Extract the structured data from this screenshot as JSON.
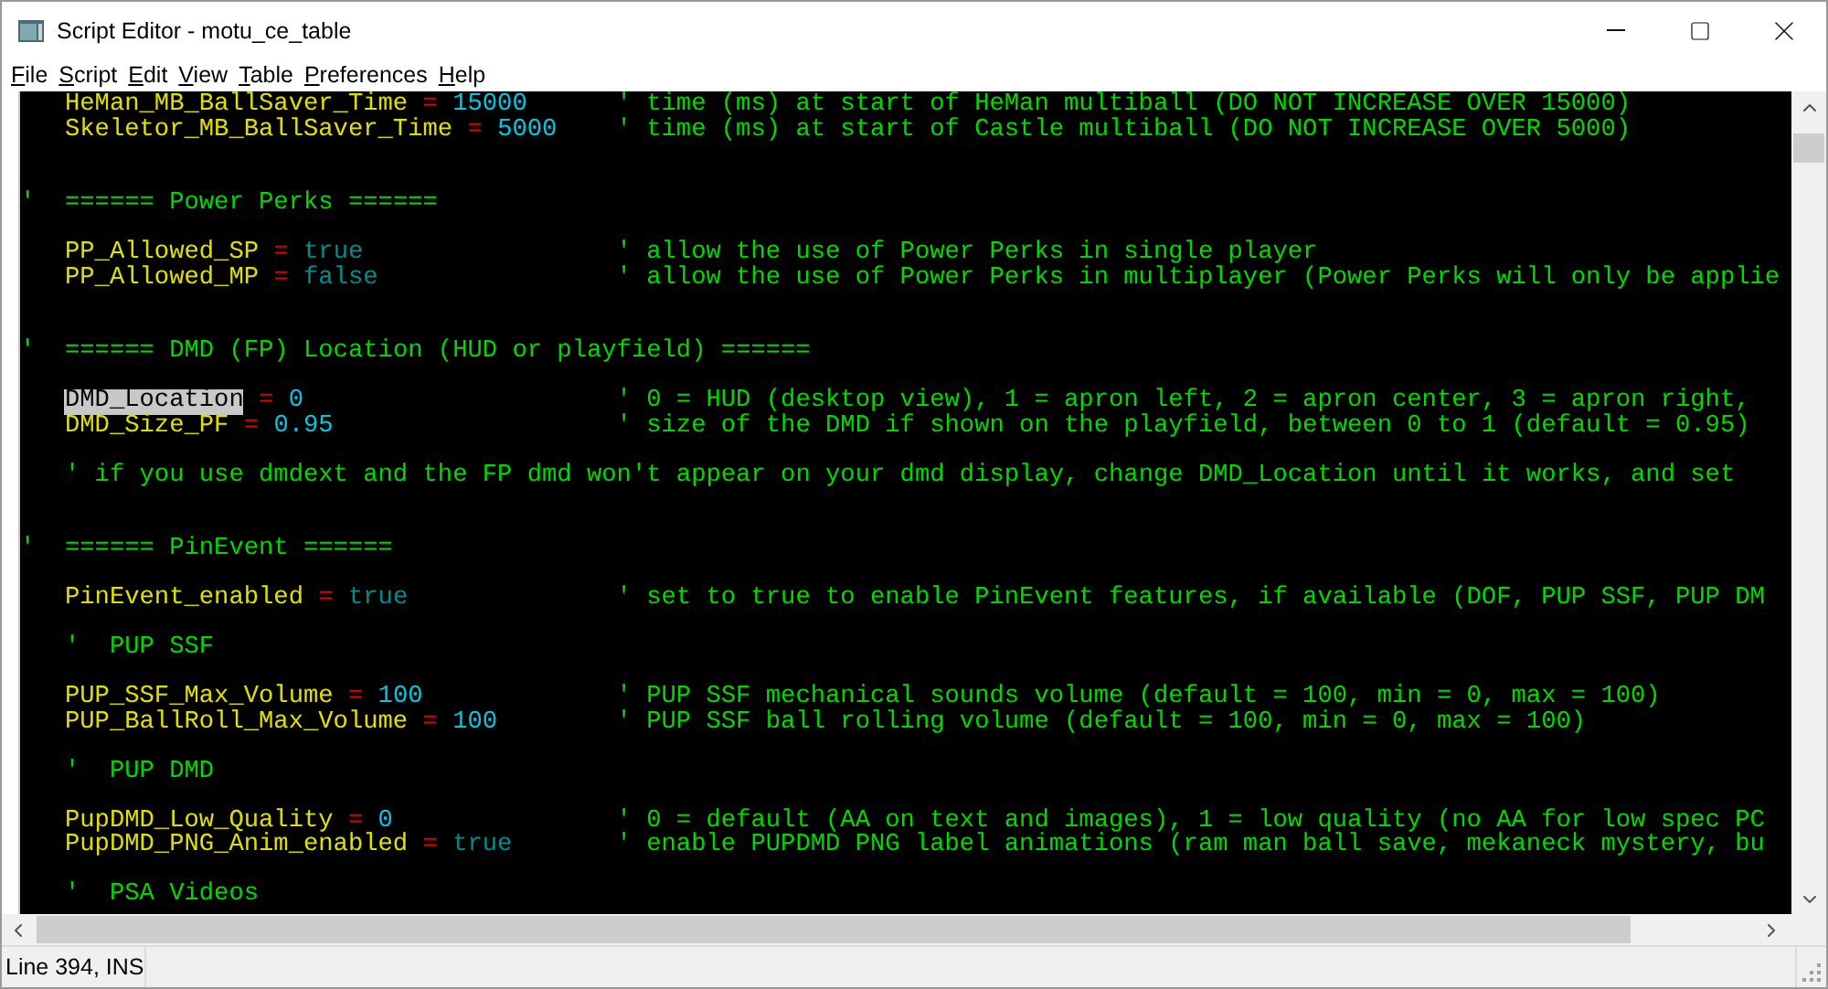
{
  "window": {
    "title": "Script Editor - motu_ce_table"
  },
  "menu": [
    "File",
    "Script",
    "Edit",
    "View",
    "Table",
    "Preferences",
    "Help"
  ],
  "editor": {
    "lines": [
      {
        "kind": "setting",
        "name": "HeMan_MB_BallSaver_Time",
        "operator": "=",
        "value": {
          "kind": "number",
          "text": "15000"
        },
        "comment": "' time (ms) at start of HeMan multiball (DO NOT INCREASE OVER 15000)",
        "selected": false
      },
      {
        "kind": "setting",
        "name": "Skeletor_MB_BallSaver_Time",
        "operator": "=",
        "value": {
          "kind": "number",
          "text": "5000"
        },
        "comment": "' time (ms) at start of Castle multiball (DO NOT INCREASE OVER 5000)",
        "selected": false
      },
      {
        "kind": "blank"
      },
      {
        "kind": "blank"
      },
      {
        "kind": "section",
        "text": "'  ====== Power Perks ======"
      },
      {
        "kind": "blank"
      },
      {
        "kind": "setting",
        "name": "PP_Allowed_SP",
        "operator": "=",
        "value": {
          "kind": "boolean",
          "text": "true"
        },
        "comment": "' allow the use of Power Perks in single player",
        "selected": false
      },
      {
        "kind": "setting",
        "name": "PP_Allowed_MP",
        "operator": "=",
        "value": {
          "kind": "boolean",
          "text": "false"
        },
        "comment": "' allow the use of Power Perks in multiplayer (Power Perks will only be applie",
        "selected": false
      },
      {
        "kind": "blank"
      },
      {
        "kind": "blank"
      },
      {
        "kind": "section",
        "text": "'  ====== DMD (FP) Location (HUD or playfield) ======"
      },
      {
        "kind": "blank"
      },
      {
        "kind": "setting",
        "name": "DMD_Location",
        "operator": "=",
        "value": {
          "kind": "number",
          "text": "0"
        },
        "comment": "' 0 = HUD (desktop view), 1 = apron left, 2 = apron center, 3 = apron right,",
        "selected": true
      },
      {
        "kind": "setting",
        "name": "DMD_Size_PF",
        "operator": "=",
        "value": {
          "kind": "number",
          "text": "0.95"
        },
        "comment": "' size of the DMD if shown on the playfield, between 0 to 1 (default = 0.95)",
        "selected": false
      },
      {
        "kind": "blank"
      },
      {
        "kind": "note",
        "text": "' if you use dmdext and the FP dmd won't appear on your dmd display, change DMD_Location until it works, and set"
      },
      {
        "kind": "blank"
      },
      {
        "kind": "blank"
      },
      {
        "kind": "section",
        "text": "'  ====== PinEvent ======"
      },
      {
        "kind": "blank"
      },
      {
        "kind": "setting",
        "name": "PinEvent_enabled",
        "operator": "=",
        "value": {
          "kind": "boolean",
          "text": "true"
        },
        "comment": "' set to true to enable PinEvent features, if available (DOF, PUP SSF, PUP DM",
        "selected": false
      },
      {
        "kind": "blank"
      },
      {
        "kind": "note",
        "text": "'  PUP SSF"
      },
      {
        "kind": "blank"
      },
      {
        "kind": "setting",
        "name": "PUP_SSF_Max_Volume",
        "operator": "=",
        "value": {
          "kind": "number",
          "text": "100"
        },
        "comment": "' PUP SSF mechanical sounds volume (default = 100, min = 0, max = 100)",
        "selected": false
      },
      {
        "kind": "setting",
        "name": "PUP_BallRoll_Max_Volume",
        "operator": "=",
        "value": {
          "kind": "number",
          "text": "100"
        },
        "comment": "' PUP SSF ball rolling volume (default = 100, min = 0, max = 100)",
        "selected": false
      },
      {
        "kind": "blank"
      },
      {
        "kind": "note",
        "text": "'  PUP DMD"
      },
      {
        "kind": "blank"
      },
      {
        "kind": "setting",
        "name": "PupDMD_Low_Quality",
        "operator": "=",
        "value": {
          "kind": "number",
          "text": "0"
        },
        "comment": "' 0 = default (AA on text and images), 1 = low quality (no AA for low spec PC",
        "selected": false
      },
      {
        "kind": "setting",
        "name": "PupDMD_PNG_Anim_enabled",
        "operator": "=",
        "value": {
          "kind": "boolean",
          "text": "true"
        },
        "comment": "' enable PUPDMD PNG label animations (ram man ball save, mekaneck mystery, bu",
        "selected": false
      },
      {
        "kind": "blank"
      },
      {
        "kind": "note",
        "text": "'  PSA Videos"
      }
    ]
  },
  "status_bar": {
    "position": "Line 394, INS"
  }
}
